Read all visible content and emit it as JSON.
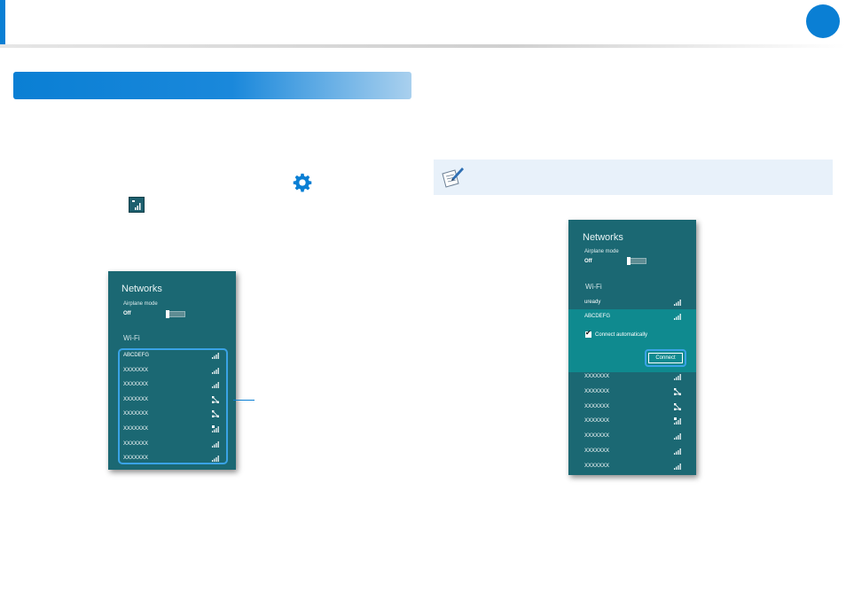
{
  "header": {
    "accent_color": "#0a7fd4"
  },
  "icons": {
    "settings": "gear-icon",
    "network": "network-icon",
    "note": "note-icon"
  },
  "left_panel": {
    "title": "Networks",
    "airplane_label": "Airplane mode",
    "airplane_state": "Off",
    "wifi_heading": "Wi-Fi",
    "networks": [
      {
        "name": "ABCDEFG",
        "icon": "signal"
      },
      {
        "name": "XXXXXXX",
        "icon": "signal"
      },
      {
        "name": "XXXXXXX",
        "icon": "signal"
      },
      {
        "name": "XXXXXXX",
        "icon": "adhoc"
      },
      {
        "name": "XXXXXXX",
        "icon": "adhoc"
      },
      {
        "name": "XXXXXXX",
        "icon": "secured-signal"
      },
      {
        "name": "XXXXXXX",
        "icon": "signal"
      },
      {
        "name": "XXXXXXX",
        "icon": "signal"
      }
    ]
  },
  "right_panel": {
    "title": "Networks",
    "airplane_label": "Airplane mode",
    "airplane_state": "Off",
    "wifi_heading": "Wi-Fi",
    "first_network": "uready",
    "selected_network": "ABCDEFG",
    "connect_auto_label": "Connect automatically",
    "connect_auto_checked": true,
    "connect_button": "Connect",
    "networks": [
      {
        "name": "XXXXXXX",
        "icon": "signal"
      },
      {
        "name": "XXXXXXX",
        "icon": "adhoc"
      },
      {
        "name": "XXXXXXX",
        "icon": "adhoc"
      },
      {
        "name": "XXXXXXX",
        "icon": "secured-signal"
      },
      {
        "name": "XXXXXXX",
        "icon": "signal"
      },
      {
        "name": "XXXXXXX",
        "icon": "signal"
      },
      {
        "name": "XXXXXXX",
        "icon": "signal"
      }
    ]
  }
}
